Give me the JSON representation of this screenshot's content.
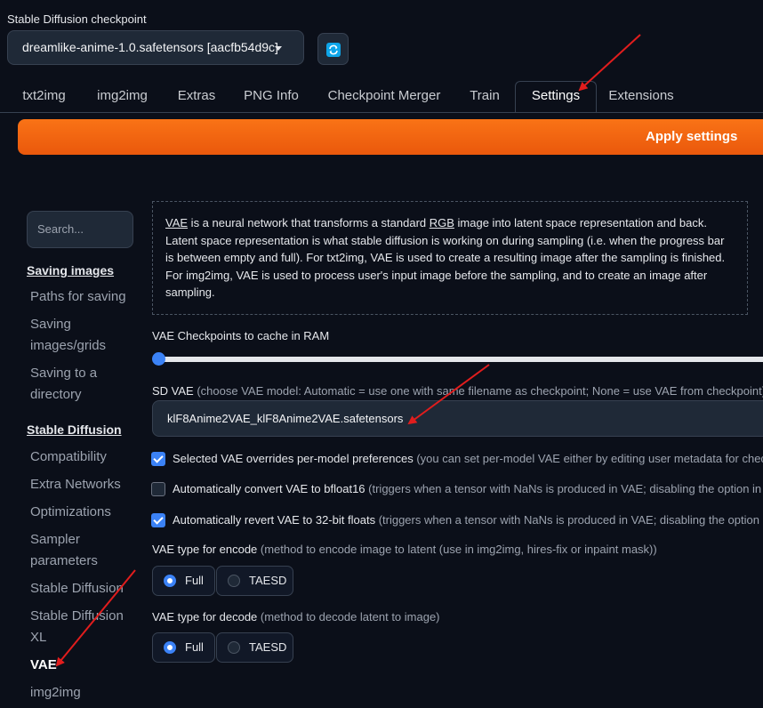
{
  "header": {
    "checkpoint_label": "Stable Diffusion checkpoint",
    "checkpoint_value": "dreamlike-anime-1.0.safetensors [aacfb54d9c]"
  },
  "tabs": [
    "txt2img",
    "img2img",
    "Extras",
    "PNG Info",
    "Checkpoint Merger",
    "Train",
    "Settings",
    "Extensions"
  ],
  "active_tab": "Settings",
  "apply_label": "Apply settings",
  "sidebar": {
    "search_placeholder": "Search...",
    "items": [
      {
        "label": "Saving images",
        "type": "section"
      },
      {
        "label": "Paths for saving"
      },
      {
        "label": "Saving images/grids"
      },
      {
        "label": "Saving to a directory"
      },
      {
        "label": "Stable Diffusion",
        "type": "section"
      },
      {
        "label": "Compatibility"
      },
      {
        "label": "Extra Networks"
      },
      {
        "label": "Optimizations"
      },
      {
        "label": "Sampler parameters"
      },
      {
        "label": "Stable Diffusion"
      },
      {
        "label": "Stable Diffusion XL"
      },
      {
        "label": "VAE",
        "current": true
      },
      {
        "label": "img2img"
      }
    ]
  },
  "vae": {
    "info": {
      "vae_word": "VAE",
      "t1": " is a neural network that transforms a standard ",
      "rgb_word": "RGB",
      "t2": " image into latent space representation and back. Latent space representation is what stable diffusion is working on during sampling (i.e. when the progress bar is between empty and full). For txt2img, VAE is used to create a resulting image after the sampling is finished. For img2img, VAE is used to process user's input image before the sampling, and to create an image after sampling."
    },
    "cache_label": "VAE Checkpoints to cache in RAM",
    "cache_value": 0,
    "sd_vae_label": "SD VAE",
    "sd_vae_hint": " (choose VAE model: Automatic = use one with same filename as checkpoint; None = use VAE from checkpoint)",
    "sd_vae_value": "klF8Anime2VAE_klF8Anime2VAE.safetensors",
    "checkboxes": [
      {
        "label": "Selected VAE overrides per-model preferences",
        "hint": " (you can set per-model VAE either by editing user metadata for chec",
        "checked": true
      },
      {
        "label": "Automatically convert VAE to bfloat16",
        "hint": " (triggers when a tensor with NaNs is produced in VAE; disabling the option in",
        "checked": false
      },
      {
        "label": "Automatically revert VAE to 32-bit floats",
        "hint": " (triggers when a tensor with NaNs is produced in VAE; disabling the option",
        "checked": true
      }
    ],
    "encode_label": "VAE type for encode",
    "encode_hint": " (method to encode image to latent (use in img2img, hires-fix or inpaint mask))",
    "decode_label": "VAE type for decode",
    "decode_hint": " (method to decode latent to image)",
    "radio_options": [
      "Full",
      "TAESD"
    ],
    "encode_selected": "Full",
    "decode_selected": "Full"
  },
  "colors": {
    "accent_orange": "#f97316",
    "accent_blue": "#3b82f6",
    "annotation_arrow": "#e11d1d"
  }
}
